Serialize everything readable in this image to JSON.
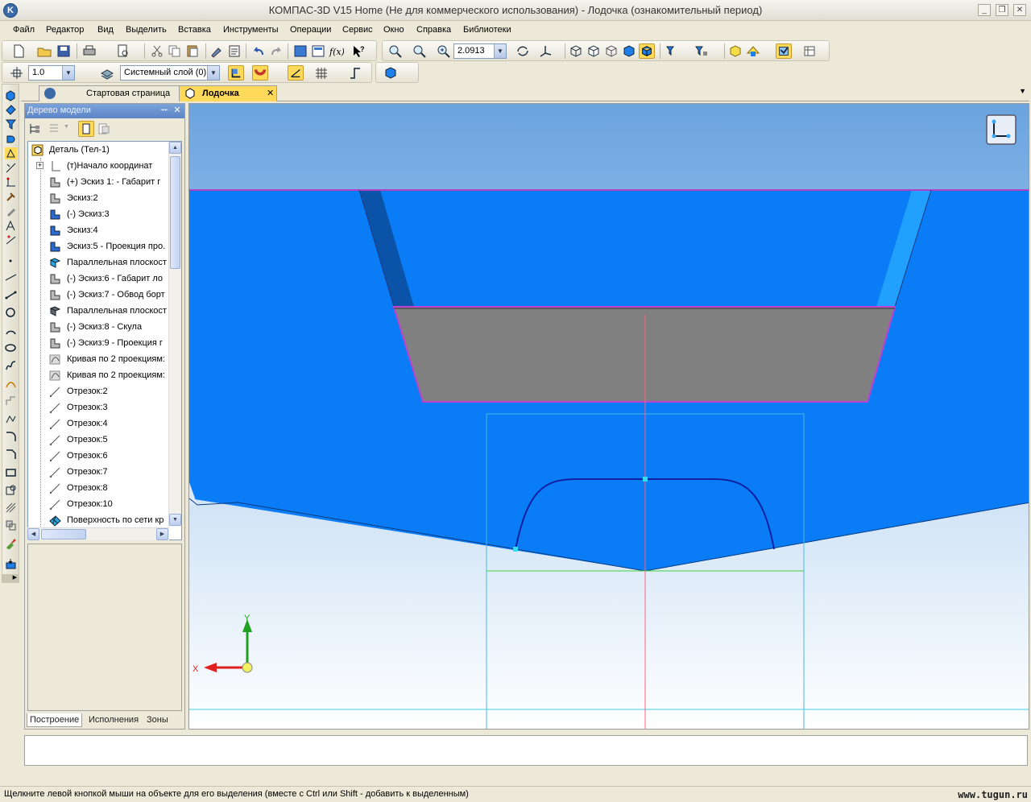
{
  "window": {
    "title": "КОМПАС-3D V15 Home (Не для коммерческого использования) - Лодочка (ознакомительный период)"
  },
  "menu": [
    "Файл",
    "Редактор",
    "Вид",
    "Выделить",
    "Вставка",
    "Инструменты",
    "Операции",
    "Сервис",
    "Окно",
    "Справка",
    "Библиотеки"
  ],
  "toolbar_top": {
    "zoom_value": "2.0913"
  },
  "toolbar_second": {
    "step_value": "1.0",
    "layer_value": "Системный слой (0)"
  },
  "tabs": [
    {
      "label": "Стартовая страница",
      "active": false
    },
    {
      "label": "Лодочка",
      "active": true
    }
  ],
  "tree_panel": {
    "title": "Дерево модели",
    "items": [
      {
        "label": "Деталь (Тел-1)"
      },
      {
        "label": "(т)Начало координат"
      },
      {
        "label": "(+) Эскиз 1: - Габарит г"
      },
      {
        "label": "Эскиз:2"
      },
      {
        "label": "(-) Эскиз:3"
      },
      {
        "label": "Эскиз:4"
      },
      {
        "label": "Эскиз:5 - Проекция про."
      },
      {
        "label": "Параллельная плоскост"
      },
      {
        "label": "(-) Эскиз:6 - Габарит ло"
      },
      {
        "label": "(-) Эскиз:7 - Обвод борт"
      },
      {
        "label": "Параллельная плоскост"
      },
      {
        "label": "(-) Эскиз:8 - Скула"
      },
      {
        "label": "(-) Эскиз:9 - Проекция г"
      },
      {
        "label": "Кривая по 2 проекциям:"
      },
      {
        "label": "Кривая по 2 проекциям:"
      },
      {
        "label": "Отрезок:2"
      },
      {
        "label": "Отрезок:3"
      },
      {
        "label": "Отрезок:4"
      },
      {
        "label": "Отрезок:5"
      },
      {
        "label": "Отрезок:6"
      },
      {
        "label": "Отрезок:7"
      },
      {
        "label": "Отрезок:8"
      },
      {
        "label": "Отрезок:10"
      },
      {
        "label": "Поверхность по сети кр"
      }
    ],
    "bottom_tabs": [
      "Построение",
      "Исполнения",
      "Зоны"
    ]
  },
  "axis_labels": {
    "x": "X",
    "y": "Y"
  },
  "status": {
    "message": "Щелкните левой кнопкой мыши на объекте для его выделения (вместе с Ctrl или Shift - добавить к выделенным)",
    "watermark": "www.tugun.ru"
  },
  "colors": {
    "viewport_blue": "#0a7cf5",
    "gray_face": "#808080",
    "sky_top": "#6da7e2",
    "accent_yellow": "#ffd95a"
  }
}
